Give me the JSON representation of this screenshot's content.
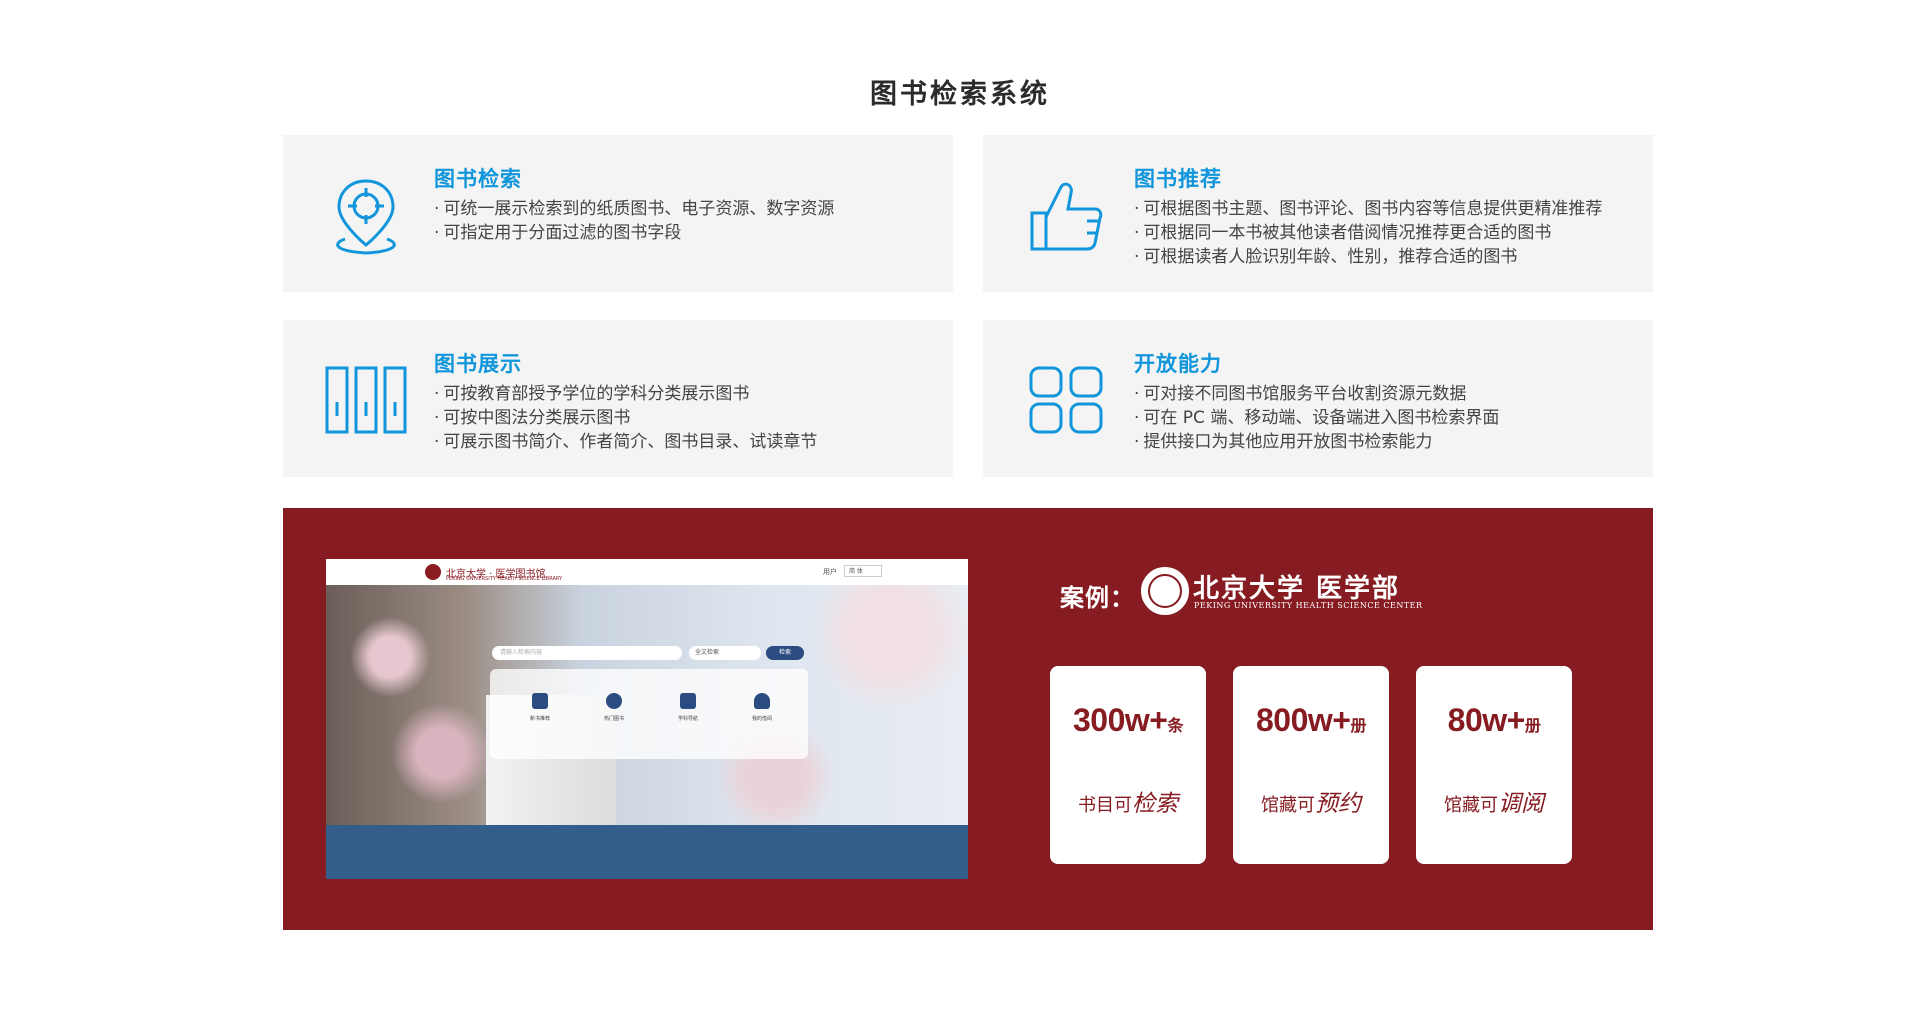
{
  "page_title": "图书检索系统",
  "features": [
    {
      "icon": "location-target-icon",
      "title": "图书检索",
      "lines": [
        "可统一展示检索到的纸质图书、电子资源、数字资源",
        "可指定用于分面过滤的图书字段"
      ]
    },
    {
      "icon": "thumbs-up-icon",
      "title": "图书推荐",
      "lines": [
        "可根据图书主题、图书评论、图书内容等信息提供更精准推荐",
        "可根据同一本书被其他读者借阅情况推荐更合适的图书",
        "可根据读者人脸识别年龄、性别，推荐合适的图书"
      ]
    },
    {
      "icon": "bookshelf-icon",
      "title": "图书展示",
      "lines": [
        "可按教育部授予学位的学科分类展示图书",
        "可按中图法分类展示图书",
        "可展示图书简介、作者简介、图书目录、试读章节"
      ]
    },
    {
      "icon": "app-grid-icon",
      "title": "开放能力",
      "lines": [
        "可对接不同图书馆服务平台收割资源元数据",
        "可在 PC 端、移动端、设备端进入图书检索界面",
        "提供接口为其他应用开放图书检索能力"
      ]
    }
  ],
  "bullet": "·",
  "case": {
    "label": "案例：",
    "org_name": "北京大学 医学部",
    "org_subtitle": "PEKING UNIVERSITY HEALTH SCIENCE CENTER",
    "stats": [
      {
        "number": "300w+",
        "unit": "条",
        "desc_prefix": "书目可",
        "desc_emph": "检索"
      },
      {
        "number": "800w+",
        "unit": "册",
        "desc_prefix": "馆藏可",
        "desc_emph": "预约"
      },
      {
        "number": "80w+",
        "unit": "册",
        "desc_prefix": "馆藏可",
        "desc_emph": "调阅"
      }
    ]
  },
  "screenshot": {
    "logo_text": "北京大学 · 医学图书馆",
    "logo_sub": "PEKING UNIVERSITY HEALTH SCIENCE LIBRARY",
    "user": "用户",
    "lang": "简 体",
    "search_placeholder": "请输入检索内容",
    "select_value": "全文检索",
    "search_button": "检索",
    "tiles": [
      "新书推荐",
      "热门图书",
      "学科导航",
      "我的借阅"
    ]
  },
  "colors": {
    "accent_blue": "#1296db",
    "brand_red": "#861c21",
    "card_bg": "#f4f4f4",
    "screenshot_footer": "#335d8a"
  }
}
